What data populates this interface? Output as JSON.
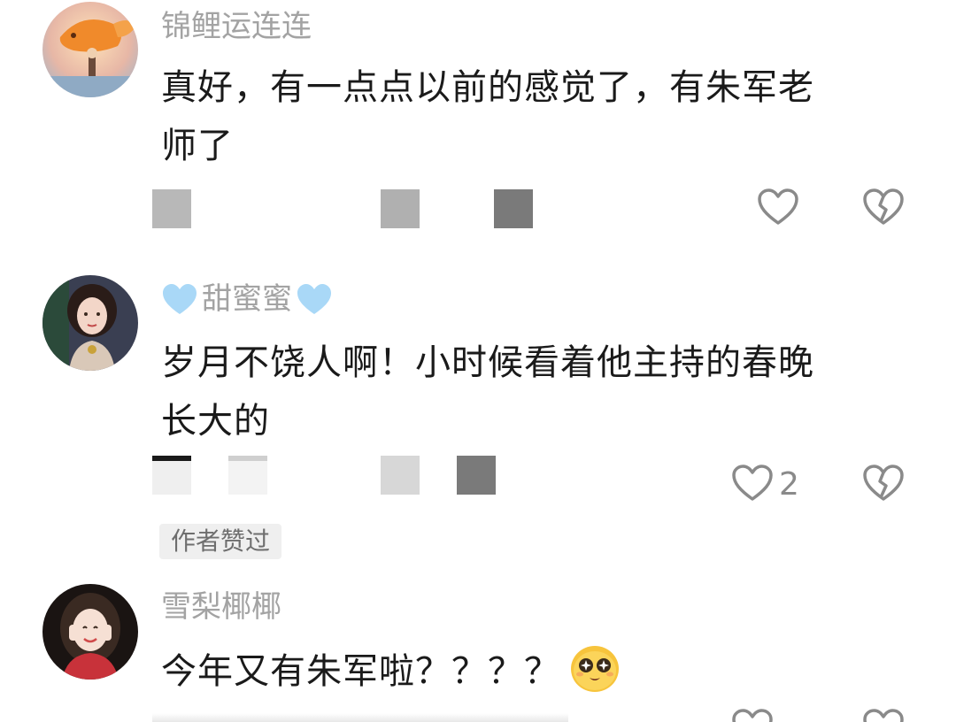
{
  "comments": [
    {
      "username": "锦鲤运连连",
      "avatar_icon": "koi-avatar-icon",
      "text_line1": "真好，有一点点以前的感觉了，有朱军老",
      "text_line2": "师了",
      "like_count": "",
      "liked_by_author": false
    },
    {
      "username": "甜蜜蜜",
      "username_decoration": "blue-heart-emoji",
      "avatar_icon": "woman-portrait-avatar-icon",
      "text_line1": "岁月不饶人啊！小时候看着他主持的春晚",
      "text_line2": "长大的",
      "like_count": "2",
      "liked_by_author": true,
      "author_badge": "作者赞过"
    },
    {
      "username": "雪梨椰椰",
      "avatar_icon": "girl-portrait-avatar-icon",
      "text_line1": "今年又有朱军啦？？？？",
      "emoji": "starry-eyes-emoji",
      "like_count": ""
    }
  ],
  "colors": {
    "username": "#a3a3a3",
    "text": "#1a1a1a",
    "icon_stroke": "#8a8a8a",
    "blue_heart": "#a9d8f7"
  }
}
